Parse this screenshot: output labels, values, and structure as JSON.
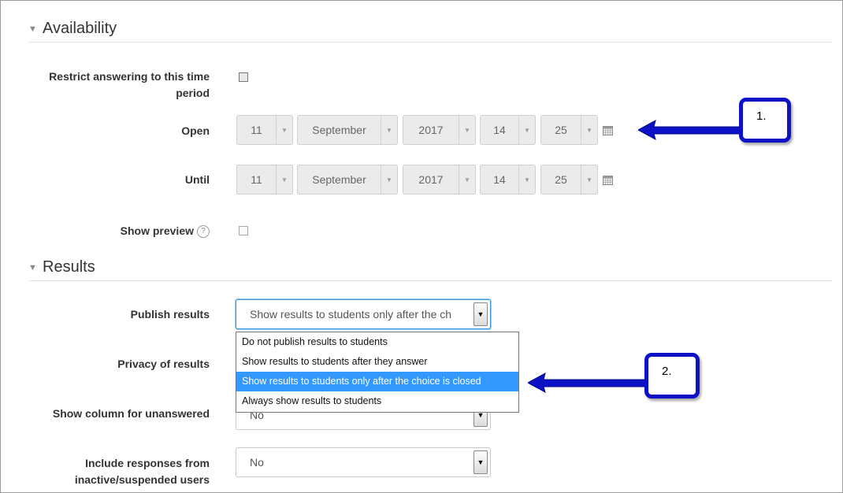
{
  "availability": {
    "heading": "Availability",
    "restrict_label_1": "Restrict answering to this time",
    "restrict_label_2": "period",
    "open_label": "Open",
    "until_label": "Until",
    "show_preview_label": "Show preview",
    "open": {
      "day": "11",
      "month": "September",
      "year": "2017",
      "hour": "14",
      "minute": "25"
    },
    "until": {
      "day": "11",
      "month": "September",
      "year": "2017",
      "hour": "14",
      "minute": "25"
    }
  },
  "results": {
    "heading": "Results",
    "publish_label": "Publish results",
    "publish_value": "Show results to students only after the ch",
    "privacy_label": "Privacy of results",
    "unanswered_label": "Show column for unanswered",
    "unanswered_value": "No",
    "include_label_1": "Include responses from",
    "include_label_2": "inactive/suspended users",
    "include_value": "No",
    "dropdown_options": [
      "Do not publish results to students",
      "Show results to students after they answer",
      "Show results to students only after the choice is closed",
      "Always show results to students"
    ],
    "selected_option_index": 2
  },
  "annotations": {
    "callout_1": "1.",
    "callout_2": "2."
  },
  "colors": {
    "callout_blue": "#0d12c7",
    "highlight": "#3399ff"
  },
  "icons": [
    "triangle-down-icon",
    "calendar-icon",
    "help-icon",
    "arrow-left-icon"
  ]
}
